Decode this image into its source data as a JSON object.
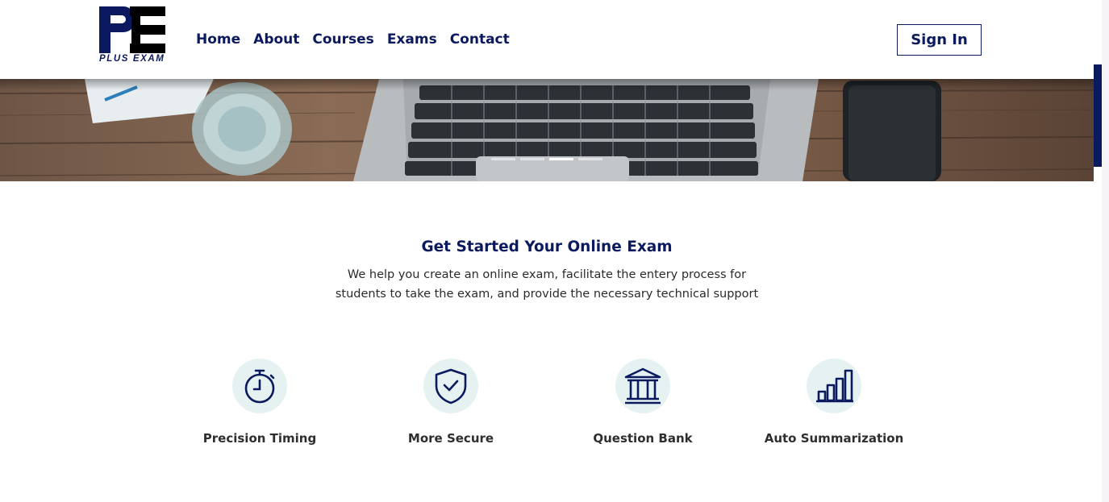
{
  "brand": {
    "logo_text": "PLUS EXAM",
    "color": "#0b1a5e"
  },
  "nav": {
    "items": [
      "Home",
      "About",
      "Courses",
      "Exams",
      "Contact"
    ]
  },
  "header": {
    "signin_label": "Sign In"
  },
  "hero": {
    "slide_count": 4,
    "active_slide_index": 2
  },
  "intro": {
    "title": "Get Started Your Online Exam",
    "text": "We help you create an online exam, facilitate the entery process for students to take the exam, and provide the necessary technical support"
  },
  "features": [
    {
      "icon": "stopwatch-icon",
      "label": "Precision Timing"
    },
    {
      "icon": "shield-check-icon",
      "label": "More Secure"
    },
    {
      "icon": "institution-icon",
      "label": "Question Bank"
    },
    {
      "icon": "bar-chart-icon",
      "label": "Auto Summarization"
    }
  ],
  "colors": {
    "accent": "#0b1a5e",
    "icon_bg": "#e6f2f2",
    "text": "#2a2a2a"
  }
}
